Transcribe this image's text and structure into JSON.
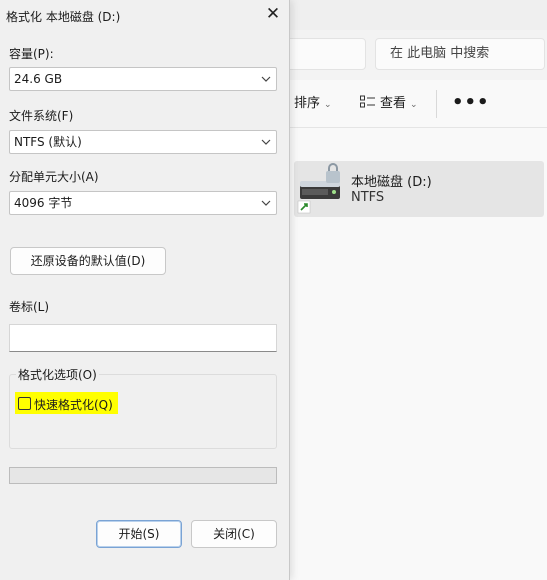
{
  "explorer": {
    "search_placeholder": "在 此电脑 中搜索",
    "toolbar": {
      "sort_label": "排序",
      "view_label": "查看",
      "more_label": "•••"
    },
    "drive": {
      "name": "本地磁盘 (D:)",
      "filesystem": "NTFS"
    }
  },
  "dialog": {
    "title": "格式化 本地磁盘 (D:)",
    "close_glyph": "✕",
    "capacity": {
      "label": "容量(P):",
      "value": "24.6 GB"
    },
    "filesystem": {
      "label": "文件系统(F)",
      "value": "NTFS (默认)"
    },
    "allocation": {
      "label": "分配单元大小(A)",
      "value": "4096 字节"
    },
    "restore_defaults_label": "还原设备的默认值(D)",
    "volume_label": {
      "label": "卷标(L)",
      "value": ""
    },
    "format_options": {
      "legend": "格式化选项(O)",
      "quick_format_label": "快速格式化(Q)",
      "quick_format_checked": false,
      "highlight_color": "#ffff00"
    },
    "progress": 0,
    "start_label": "开始(S)",
    "close_label": "关闭(C)"
  }
}
